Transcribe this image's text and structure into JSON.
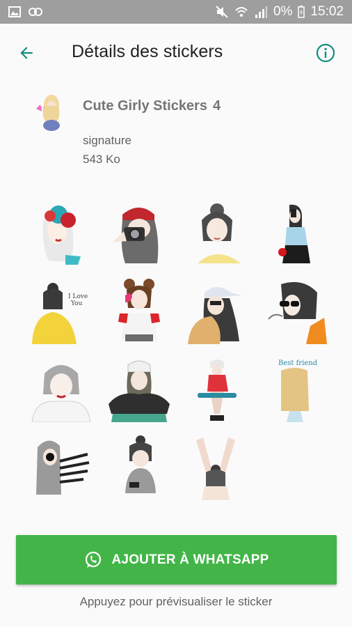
{
  "status_bar": {
    "icons_left": [
      "image-icon",
      "link-icon"
    ],
    "icons_right": [
      "mute-icon",
      "wifi-icon",
      "signal-icon"
    ],
    "battery_percent": "0%",
    "time": "15:02"
  },
  "app_bar": {
    "title": "Détails des stickers",
    "back_icon": "arrow-back-icon",
    "info_icon": "info-icon",
    "accent_color": "#128c7e"
  },
  "pack": {
    "name": "Cute Girly Stickers",
    "count": "4",
    "author": "signature",
    "size": "543 Ko"
  },
  "stickers": [
    {
      "name": "girl-flower-crown"
    },
    {
      "name": "girl-camera-beanie"
    },
    {
      "name": "girl-messy-bun"
    },
    {
      "name": "girl-phone-selfie"
    },
    {
      "name": "girl-i-love-you"
    },
    {
      "name": "girl-buns-heart"
    },
    {
      "name": "girl-cap"
    },
    {
      "name": "girl-sunglasses"
    },
    {
      "name": "girl-silver-hair"
    },
    {
      "name": "girl-beanie-sitting"
    },
    {
      "name": "girl-skateboard"
    },
    {
      "name": "girl-best-friend"
    },
    {
      "name": "girl-striped-shirt"
    },
    {
      "name": "girl-on-phone"
    },
    {
      "name": "girl-arms-up"
    }
  ],
  "add_button": {
    "label": "AJOUTER À WHATSAPP",
    "icon": "whatsapp-icon",
    "color": "#43b548"
  },
  "hint": "Appuyez pour prévisualiser le sticker"
}
